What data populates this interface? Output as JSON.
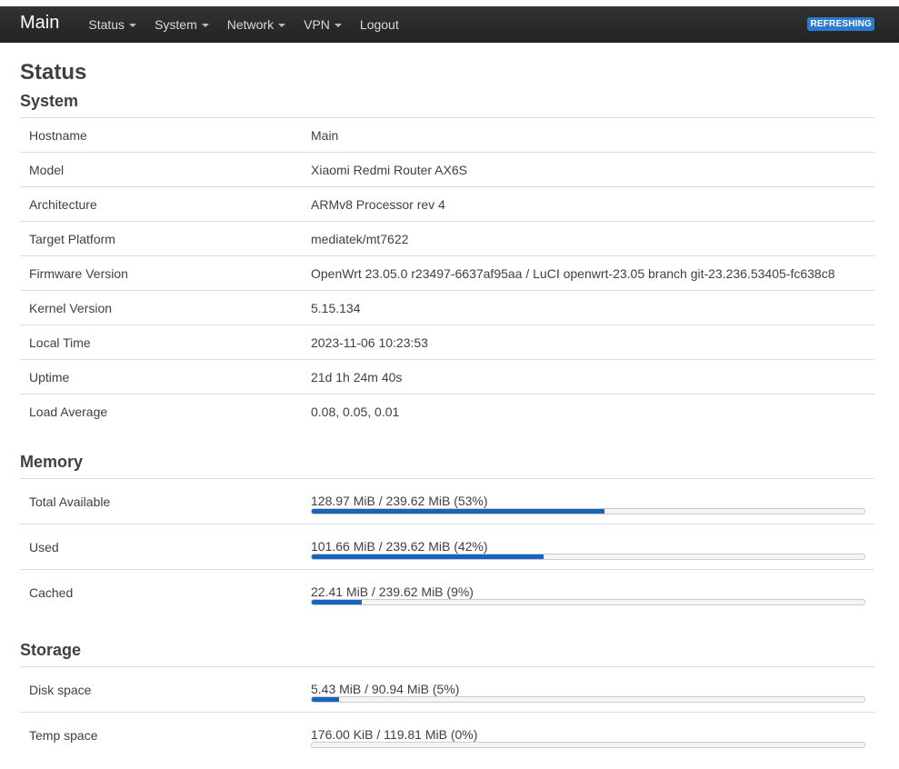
{
  "nav": {
    "brand": "Main",
    "items": [
      "Status",
      "System",
      "Network",
      "VPN",
      "Logout"
    ],
    "badge": "REFRESHING"
  },
  "page": {
    "title": "Status"
  },
  "system": {
    "title": "System",
    "rows": [
      {
        "label": "Hostname",
        "value": "Main"
      },
      {
        "label": "Model",
        "value": "Xiaomi Redmi Router AX6S"
      },
      {
        "label": "Architecture",
        "value": "ARMv8 Processor rev 4"
      },
      {
        "label": "Target Platform",
        "value": "mediatek/mt7622"
      },
      {
        "label": "Firmware Version",
        "value": "OpenWrt 23.05.0 r23497-6637af95aa / LuCI openwrt-23.05 branch git-23.236.53405-fc638c8"
      },
      {
        "label": "Kernel Version",
        "value": "5.15.134"
      },
      {
        "label": "Local Time",
        "value": "2023-11-06 10:23:53"
      },
      {
        "label": "Uptime",
        "value": "21d 1h 24m 40s"
      },
      {
        "label": "Load Average",
        "value": "0.08, 0.05, 0.01"
      }
    ]
  },
  "memory": {
    "title": "Memory",
    "rows": [
      {
        "label": "Total Available",
        "text": "128.97 MiB / 239.62 MiB (53%)",
        "percent": 53
      },
      {
        "label": "Used",
        "text": "101.66 MiB / 239.62 MiB (42%)",
        "percent": 42
      },
      {
        "label": "Cached",
        "text": "22.41 MiB / 239.62 MiB (9%)",
        "percent": 9
      }
    ]
  },
  "storage": {
    "title": "Storage",
    "rows": [
      {
        "label": "Disk space",
        "text": "5.43 MiB / 90.94 MiB (5%)",
        "percent": 5
      },
      {
        "label": "Temp space",
        "text": "176.00 KiB / 119.81 MiB (0%)",
        "percent": 0
      }
    ]
  },
  "colors": {
    "bar_fill": "#1565c0",
    "navbar": "#222222",
    "badge": "#2a7ad1"
  }
}
